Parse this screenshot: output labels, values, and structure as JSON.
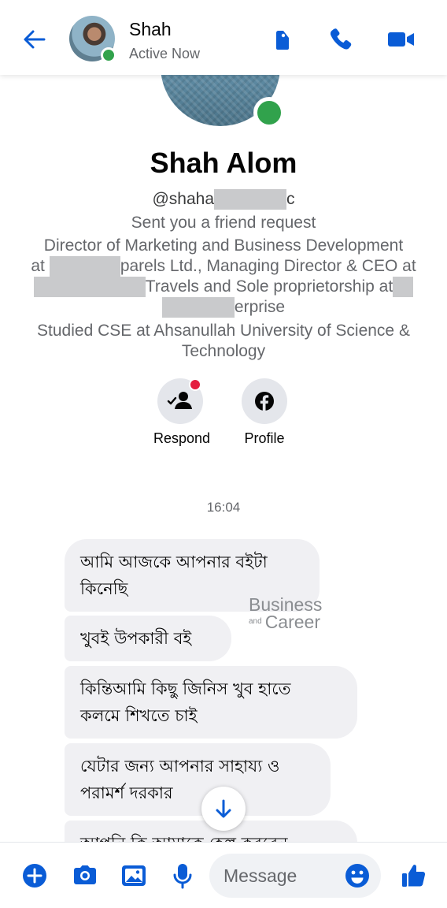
{
  "header": {
    "name": "Shah",
    "status": "Active Now"
  },
  "profile": {
    "name": "Shah Alom",
    "username_prefix": "@shaha",
    "username_suffix": "c",
    "friend_request": "Sent you a friend request",
    "work_line1": "Director of Marketing and Business Development",
    "work_line2_prefix": "at",
    "work_line2_suffix": "parels Ltd., Managing Director & CEO at",
    "work_line3_suffix": "Travels and Sole proprietorship at",
    "work_line4_suffix": "erprise",
    "education_line1": "Studied CSE at Ahsanullah University of Science &",
    "education_line2": "Technology"
  },
  "actions": {
    "respond_label": "Respond",
    "profile_label": "Profile"
  },
  "conversation": {
    "timestamp": "16:04",
    "messages": [
      {
        "line1": "আমি আজকে আপনার বইটা",
        "line2": "কিনেছি"
      },
      {
        "line1": "খুবই উপকারী বই"
      },
      {
        "line1": "কিন্তিআমি কিছু জিনিস খুব হাতে",
        "line2": "কলমে শিখতে চাই"
      },
      {
        "line1": "যেটার জন্য আপনার সাহায্য ও",
        "line2": "পরামর্শ দরকার"
      },
      {
        "line1": "আপনি কি আমাকে হেল্প করবেন"
      }
    ]
  },
  "watermark": {
    "line1": "Business",
    "small": "and",
    "line2": "Career"
  },
  "composer": {
    "placeholder": "Message"
  },
  "colors": {
    "accent": "#0a5cd6",
    "presence": "#31a24c",
    "bubble": "#f0f0f3",
    "notification": "#e41e3f"
  },
  "icons": [
    "back-arrow-icon",
    "tag-icon",
    "phone-icon",
    "video-camera-icon",
    "respond-person-icon",
    "facebook-icon",
    "arrow-down-icon",
    "plus-icon",
    "camera-icon",
    "image-icon",
    "microphone-icon",
    "emoji-icon",
    "thumbs-up-icon"
  ]
}
